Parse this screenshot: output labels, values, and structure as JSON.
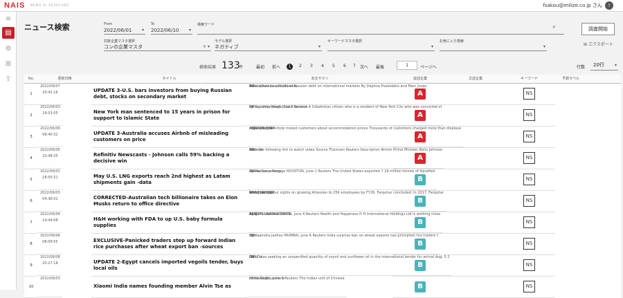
{
  "header": {
    "logo": "NAIS",
    "logo_sub": "NEWS AI SEARCHER",
    "user": "fsakou@milize.co.jp さん",
    "avatar": "!"
  },
  "page": {
    "title": "ニュース検索"
  },
  "form": {
    "from_label": "From",
    "from_value": "2022/06/01",
    "to_label": "To",
    "to_value": "2022/06/10",
    "keyword_label": "検索ワード",
    "keyword_value": "",
    "company_master_label": "対象企業マスタ選択",
    "company_master_value": "コンの企業マスタ",
    "model_label": "モデル選択",
    "model_value": "ネガティブ",
    "kw_master_label": "キーワードマスタ選択",
    "kw_master_value": "",
    "favorite_label": "お気に入り検索",
    "favorite_value": ""
  },
  "buttons": {
    "search": "調査開始",
    "export": "エクスポート"
  },
  "results": {
    "label": "検索結果",
    "count": "133",
    "unit": "件",
    "first": "最初",
    "prev": "前へ",
    "pages": [
      "1",
      "2",
      "3",
      "4",
      "5",
      "6",
      "7"
    ],
    "next": "次へ",
    "last": "最後",
    "page_input": "1",
    "page_suffix": "ページへ",
    "rows_label": "行数",
    "rows_value": "20行"
  },
  "columns": [
    "No.",
    "更新日時",
    "タイトル",
    "本文サマリ",
    "談話企業",
    "文話企業",
    "キーワード",
    "予測ラベル",
    "",
    ""
  ],
  "rows": [
    {
      "no": "1",
      "date": "2022/06/07",
      "time": "20:42:16",
      "title": "UPDATE 3-U.S. bars investors from buying Russian debt, stocks on secondary market",
      "summary": "Adds detail on amount of Russian debt on international markets By Daphne Psaledakis and Marc Jones",
      "c1": "3M",
      "c2": "3M",
      "kw": "Russia,Sanction,Oil,Moscow",
      "label": "A",
      "label_color": "#d8262e",
      "ns": "NS"
    },
    {
      "no": "2",
      "date": "2022/06/03",
      "time": "18:53:05",
      "title": "New York man sentenced to 15 years in prison for support to Islamic State",
      "summary": "By Kanishka Singh June 3 Reuters A Uzbekistan citizen who is a resident of New York City who was convicted of",
      "c1": "3M",
      "c2": "3M",
      "kw": "Syria,prime,Islamic State,terrorist",
      "label": "A",
      "label_color": "#d8262e",
      "ns": "NS"
    },
    {
      "no": "3",
      "date": "2022/06/06",
      "time": "08:40:32",
      "title": "UPDATE 3-Australia accuses Airbnb of misleading customers on price",
      "summary": "ACCC alleges Airbnb misled customers about accommodation prices Thousands of customers charged more than displaye",
      "c1": "AMAZON.COM",
      "c2": "AMAZON.COM",
      "kw": "regulator,fine",
      "label": "A",
      "label_color": "#d8262e",
      "ns": "NS"
    },
    {
      "no": "4",
      "date": "2022/06/05",
      "time": "23:48:35",
      "title": "Refinitiv Newscasts - Johnson calls 59% backing a decisive win",
      "summary": "Click the following link to watch video Source Thomson Reuters Description British Prime Minister Boris Johnson",
      "c1": "3M",
      "c2": "3M",
      "kw": "scandal",
      "label": "A",
      "label_color": "#d8262e",
      "ns": "NS"
    },
    {
      "no": "5",
      "date": "2022/06/01",
      "time": "18:55:51",
      "title": "May U.S. LNG exports reach 2nd highest as Latam shipments gain -data",
      "summary": "By Marianna Parraga HOUSTON, June 1 Reuters The United States exported 7.29 million tonnes of liquefied",
      "c1": "3M",
      "c2": "3M",
      "kw": "Russia,Gas,energy",
      "label": "B",
      "label_color": "#4bb3b8",
      "ns": "NS"
    },
    {
      "no": "6",
      "date": "2022/06/03",
      "time": "04:36:02",
      "title": "CORRECTED-Australian tech billionaire takes on Elon Musks return to office directive",
      "summary": "We're setting our sights on growing Atlassian to 25K employees by FY26, Farquhar concluded. In 2017, Farquhar",
      "c1": "AMAZON.COM",
      "c2": "AMAZON.COM",
      "kw": "energy,project",
      "label": "B",
      "label_color": "#4bb3b8",
      "ns": "NS"
    },
    {
      "no": "7",
      "date": "2022/06/04",
      "time": "14:44:08",
      "title": "H&H working with FDA to up U.S. baby formula supplies",
      "summary": "By Richa Naidu LONDON, June 4 Reuters Health and Happiness H H International Holdings Ltd is working close",
      "c1": "ABBOTT LABORATORIES",
      "c2": "ABBOTT LABORATORIES",
      "kw": "drug",
      "label": "B",
      "label_color": "#4bb3b8",
      "ns": "NS"
    },
    {
      "no": "8",
      "date": "2022/06/06",
      "time": "08:09:55",
      "title": "EXCLUSIVE-Panicked traders step up forward Indian rice purchases after wheat export ban -sources",
      "summary": "By Rajendra Jadhav MUMBAI, June 6 Reuters India surprise ban on wheat exports has prompted rice traders t",
      "c1": "3M",
      "c2": "3M",
      "kw": "Iran",
      "label": "B",
      "label_color": "#4bb3b8",
      "ns": "NS"
    },
    {
      "no": "9",
      "date": "2022/06/08",
      "time": "20:27:18",
      "title": "UPDATE 2-Egypt cancels imported vegoils tender, buys local oils",
      "summary": "GASC was seeking an unspecified quantity of soyoil and sunflower oil in the international tender for arrival Aug. 5 2",
      "c1": "3M",
      "c2": "3M",
      "kw": "Gas,Oil",
      "label": "B",
      "label_color": "#4bb3b8",
      "ns": "NS"
    },
    {
      "no": "10",
      "date": "2022/06/03",
      "time": "",
      "title": "Xiaomi India names founding member Alvin Tse as",
      "summary": "BENGALURU, June 3 Reuters The Indian unit of Chinese",
      "c1": "",
      "c2": "",
      "kw": "crime,illegal,enforce",
      "label": "B",
      "label_color": "#4bb3b8",
      "ns": "NS"
    }
  ]
}
